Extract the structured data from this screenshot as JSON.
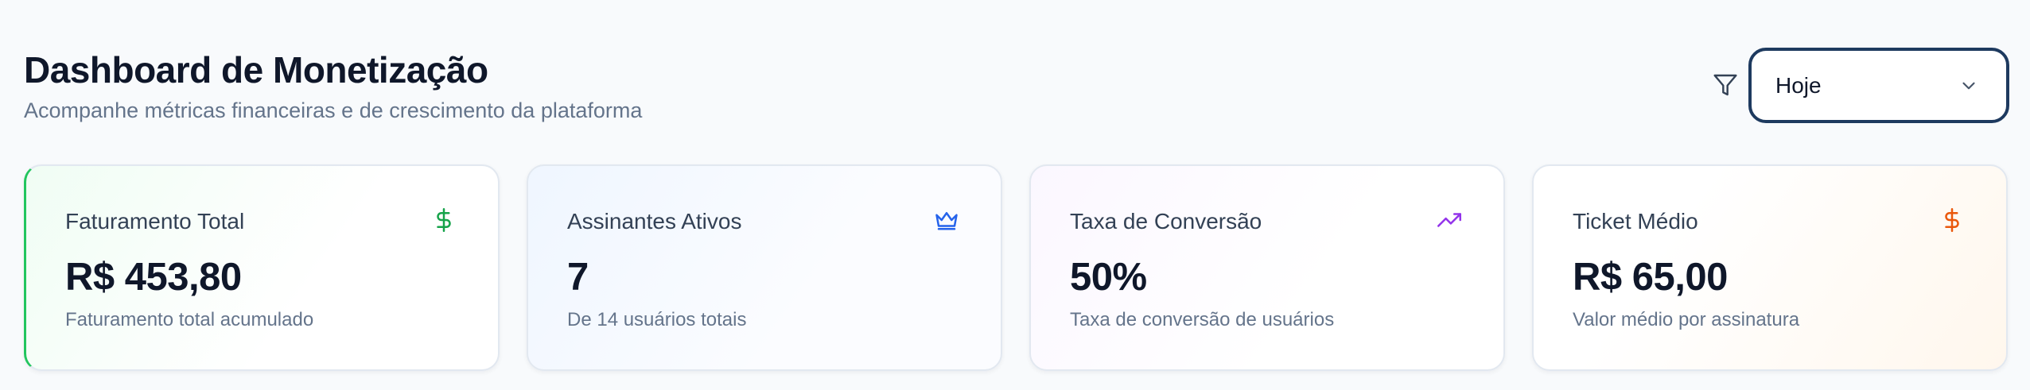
{
  "header": {
    "title": "Dashboard de Monetização",
    "subtitle": "Acompanhe métricas financeiras e de crescimento da plataforma"
  },
  "filter": {
    "icon": "filter-icon",
    "period_select": {
      "value": "Hoje",
      "icon": "chevron-down-icon"
    }
  },
  "cards": [
    {
      "label": "Faturamento Total",
      "value": "R$ 453,80",
      "description": "Faturamento total acumulado",
      "icon": "dollar-sign-icon",
      "accent": "#16a34a"
    },
    {
      "label": "Assinantes Ativos",
      "value": "7",
      "description": "De 14 usuários totais",
      "icon": "crown-icon",
      "accent": "#2563eb"
    },
    {
      "label": "Taxa de Conversão",
      "value": "50%",
      "description": "Taxa de conversão de usuários",
      "icon": "trending-up-icon",
      "accent": "#9333ea"
    },
    {
      "label": "Ticket Médio",
      "value": "R$ 65,00",
      "description": "Valor médio por assinatura",
      "icon": "dollar-sign-icon",
      "accent": "#ea580c"
    }
  ]
}
